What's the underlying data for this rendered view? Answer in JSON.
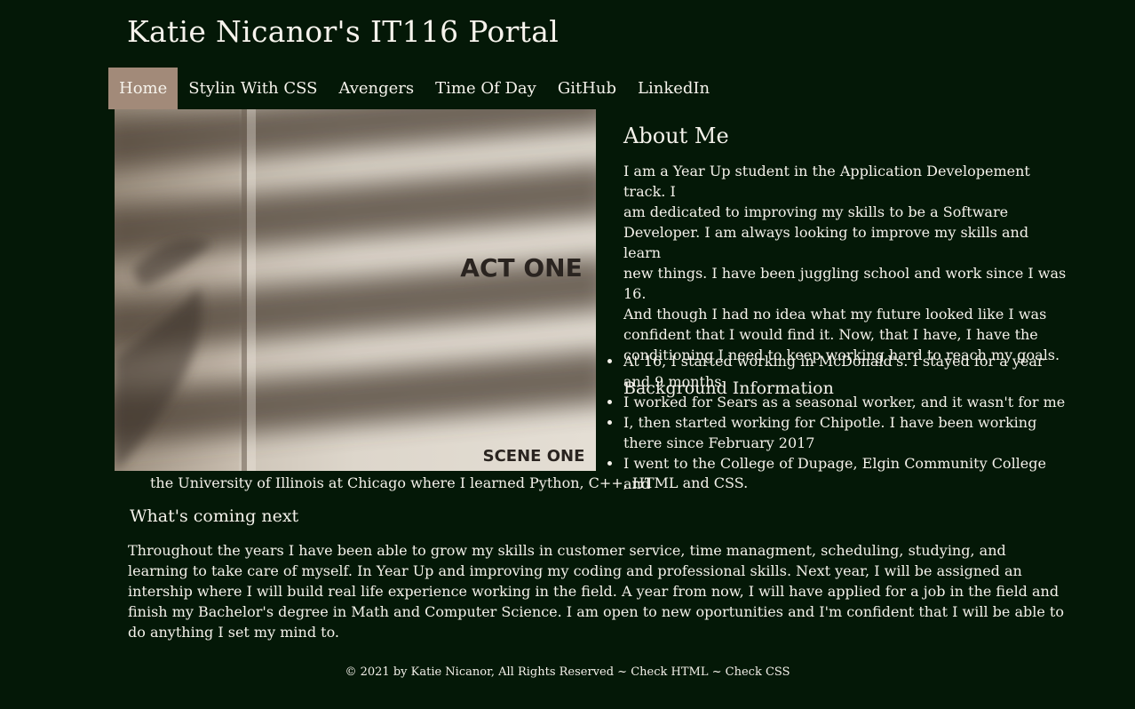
{
  "site": {
    "title": "Katie Nicanor's IT116 Portal"
  },
  "nav": {
    "items": [
      {
        "label": "Home",
        "active": true
      },
      {
        "label": "Stylin With CSS",
        "active": false
      },
      {
        "label": "Avengers",
        "active": false
      },
      {
        "label": "Time Of Day",
        "active": false
      },
      {
        "label": "GitHub",
        "active": false
      },
      {
        "label": "LinkedIn",
        "active": false
      }
    ]
  },
  "hero": {
    "act_text": "ACT ONE",
    "scene_text": "SCENE ONE"
  },
  "about": {
    "heading": "About Me",
    "lines": [
      "I am a Year Up student in the Application Developement track. I",
      "am dedicated to improving my skills to be a Software",
      "Developer. I am always looking to improve my skills and learn",
      "new things. I have been juggling school and work since I was 16.",
      "And though I had no idea what my future looked like I was",
      "confident that I would find it. Now, that I have, I have the",
      "conditioning I need to keep working hard to reach my goals."
    ]
  },
  "background": {
    "heading": "Background Information",
    "items": [
      "At 16, I started working in McDonald's. I stayed for a year and 9 months",
      "I worked for Sears as a seasonal worker, and it wasn't for me",
      "I, then started working for Chipotle. I have been working there since February 2017",
      "I went to the College of Dupage, Elgin Community College and"
    ],
    "last_item_continuation": "the University of Illinois at Chicago where I learned Python, C++, HTML and CSS."
  },
  "next": {
    "heading": "What's coming next",
    "text": "Throughout the years I have been able to grow my skills in customer service, time managment, scheduling, studying, and learning to take care of myself. In Year Up and improving my coding and professional skills. Next year, I will be assigned an intership where I will build real life experience working in the field. A year from now, I will have applied for a job in the field and finish my Bachelor's degree in Math and Computer Science. I am open to new oportunities and I'm confident that I will be able to do anything I set my mind to."
  },
  "footer": {
    "copyright": "© 2021 by Katie Nicanor, All Rights Reserved",
    "separator": " ~ ",
    "check_html": "Check HTML",
    "check_css": "Check CSS"
  },
  "colors": {
    "background": "#041807",
    "text": "#f4f1ea",
    "nav_active": "#a28a79"
  }
}
